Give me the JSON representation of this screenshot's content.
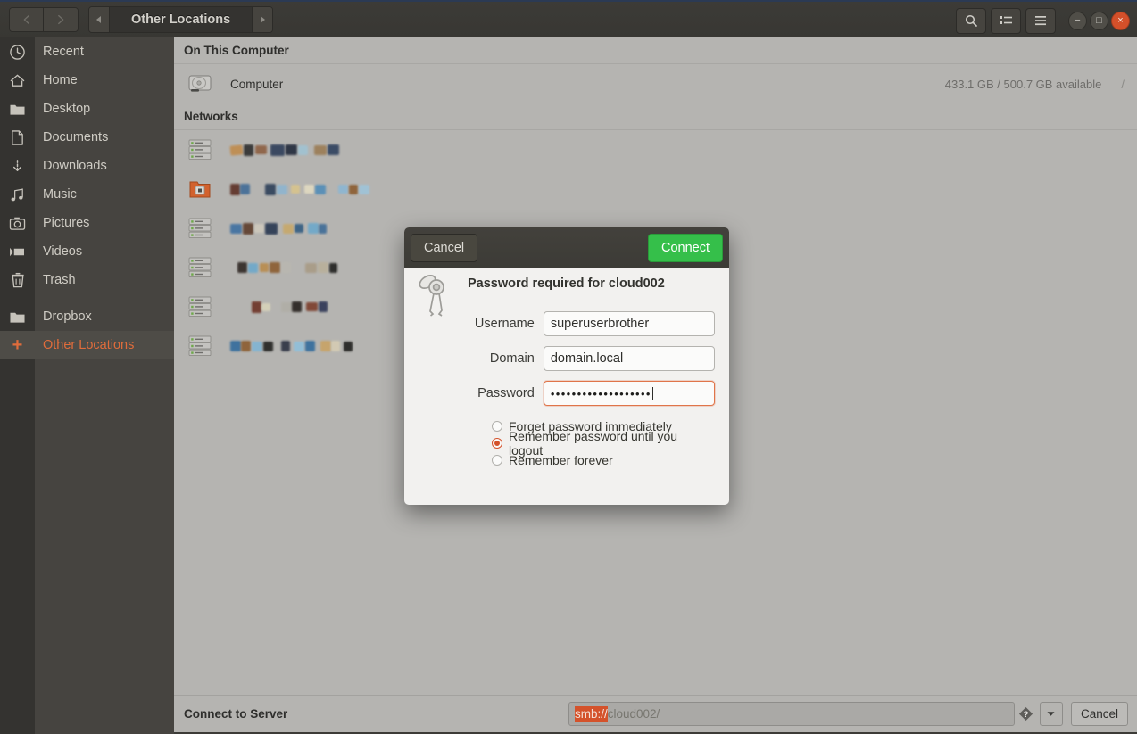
{
  "titlebar": {
    "back_icon": "chevron-left-icon",
    "forward_icon": "chevron-right-icon",
    "path_prev_icon": "triangle-left-icon",
    "path_next_icon": "triangle-right-icon",
    "current_path": "Other Locations",
    "search_icon": "search-icon",
    "view_list_icon": "list-view-icon",
    "menu_icon": "hamburger-menu-icon",
    "minimize": "−",
    "maximize": "□",
    "close": "×"
  },
  "sidebar": {
    "items": [
      {
        "label": "Recent",
        "icon": "clock-icon",
        "selected": false
      },
      {
        "label": "Home",
        "icon": "home-icon",
        "selected": false
      },
      {
        "label": "Desktop",
        "icon": "folder-icon",
        "selected": false
      },
      {
        "label": "Documents",
        "icon": "document-icon",
        "selected": false
      },
      {
        "label": "Downloads",
        "icon": "download-icon",
        "selected": false
      },
      {
        "label": "Music",
        "icon": "music-note-icon",
        "selected": false
      },
      {
        "label": "Pictures",
        "icon": "camera-icon",
        "selected": false
      },
      {
        "label": "Videos",
        "icon": "video-icon",
        "selected": false
      },
      {
        "label": "Trash",
        "icon": "trash-icon",
        "selected": false
      },
      {
        "label": "Dropbox",
        "icon": "folder-icon",
        "selected": false
      },
      {
        "label": "Other Locations",
        "icon": "plus-icon",
        "selected": true
      }
    ]
  },
  "main": {
    "sections": [
      {
        "heading": "On This Computer",
        "rows": [
          {
            "name": "Computer",
            "icon": "hard-drive-icon",
            "meta": "433.1 GB / 500.7 GB available",
            "mount": "/"
          }
        ]
      },
      {
        "heading": "Networks",
        "network_rows": [
          {
            "icon": "server-rack-icon",
            "label_redacted": true
          },
          {
            "icon": "network-folder-icon",
            "label_redacted": true
          },
          {
            "icon": "server-rack-icon",
            "label_redacted": true
          },
          {
            "icon": "server-rack-icon",
            "label_redacted": true
          },
          {
            "icon": "server-rack-icon",
            "label_redacted": true
          },
          {
            "icon": "server-rack-icon",
            "label_redacted": true
          }
        ]
      }
    ]
  },
  "bottom_bar": {
    "label": "Connect to Server",
    "address_selected": "smb://",
    "address_rest": "cloud002/",
    "help_icon": "help-diamond-icon",
    "dropdown_icon": "chevron-down-icon",
    "cancel_label": "Cancel"
  },
  "dialog": {
    "cancel_label": "Cancel",
    "connect_label": "Connect",
    "icon": "keyring-icon",
    "title": "Password required for cloud002",
    "fields": [
      {
        "label": "Username",
        "value": "superuserbrother",
        "focused": false,
        "masked": false
      },
      {
        "label": "Domain",
        "value": "domain.local",
        "focused": false,
        "masked": false
      },
      {
        "label": "Password",
        "value": "•••••••••••••••••••",
        "focused": true,
        "masked": true
      }
    ],
    "radios": [
      {
        "label": "Forget password immediately",
        "selected": false
      },
      {
        "label": "Remember password until you logout",
        "selected": true
      },
      {
        "label": "Remember forever",
        "selected": false
      }
    ]
  },
  "colors": {
    "accent_orange": "#d4522b",
    "connect_green": "#35bf4a",
    "titlebar": "#3c3b37",
    "sidebar": "#464440",
    "content_bg": "#b5b4b1"
  }
}
